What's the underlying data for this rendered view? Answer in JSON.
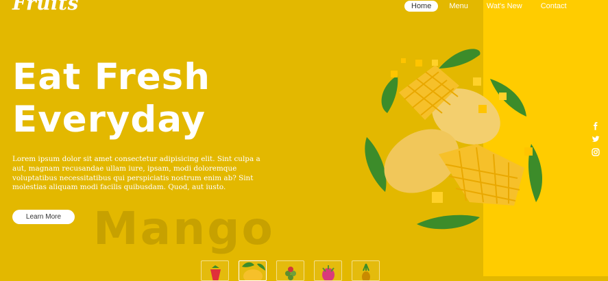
{
  "brand": {
    "logo_text": "Fruits"
  },
  "nav": {
    "items": [
      {
        "label": "Home",
        "active": true
      },
      {
        "label": "Menu"
      },
      {
        "label": "Wat's New"
      },
      {
        "label": "Contact"
      }
    ]
  },
  "hero": {
    "title_line1": "Eat Fresh",
    "title_line2": "Everyday",
    "paragraph": "Lorem ipsum dolor sit amet consectetur adipisicing elit. Sint culpa a aut, magnam recusandae ullam iure, ipsam, modi doloremque voluptatibus necessitatibus qui perspiciatis nostrum enim ab? Sint molestias aliquam modi facilis quibusdam. Quod, aut iusto.",
    "button_label": "Learn More",
    "background_word": "Mango"
  },
  "social": [
    "facebook-icon",
    "twitter-icon",
    "instagram-icon"
  ],
  "thumbnails": [
    {
      "fruit": "strawberry",
      "color": "#E0303A"
    },
    {
      "fruit": "mango",
      "color": "#F2B100",
      "active": true
    },
    {
      "fruit": "grapes",
      "color": "#5E8F2E"
    },
    {
      "fruit": "dragon-fruit",
      "color": "#D93A7A"
    },
    {
      "fruit": "pineapple",
      "color": "#C9A400"
    }
  ],
  "colors": {
    "background": "#E3B800",
    "right_panel": "#FFCC00",
    "mango_flesh": "#F6C02A",
    "mango_skin": "#F3CF6E",
    "leaf": "#3C8C2A",
    "watermark": "#C49F00"
  }
}
